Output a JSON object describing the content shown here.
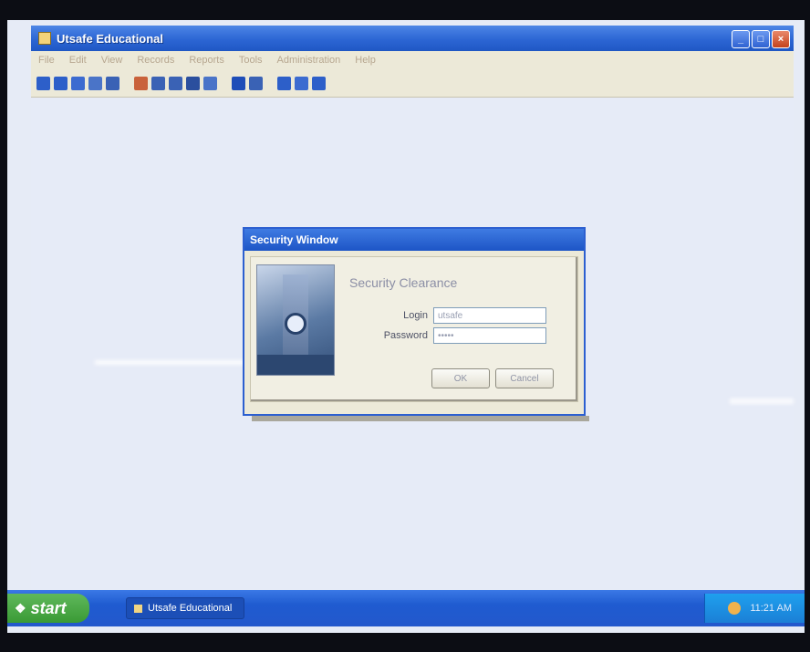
{
  "app_window": {
    "title": "Utsafe Educational",
    "menu": [
      "File",
      "Edit",
      "View",
      "Records",
      "Reports",
      "Tools",
      "Administration",
      "Help"
    ],
    "toolbar_icons": [
      {
        "name": "new-icon",
        "color": "#2d5fc9"
      },
      {
        "name": "open-icon",
        "color": "#2d5fc9"
      },
      {
        "name": "save-icon",
        "color": "#3c6bd0"
      },
      {
        "name": "edit-icon",
        "color": "#4a74c8"
      },
      {
        "name": "search-icon",
        "color": "#3a62b5"
      },
      {
        "name": "records-icon",
        "color": "#c9623b"
      },
      {
        "name": "users-icon",
        "color": "#3a62b5"
      },
      {
        "name": "reports-icon",
        "color": "#3a62b5"
      },
      {
        "name": "print-icon",
        "color": "#2b4f9e"
      },
      {
        "name": "chart-icon",
        "color": "#4a74c8"
      },
      {
        "name": "settings-icon",
        "color": "#1e4db8"
      },
      {
        "name": "help-icon",
        "color": "#3a62b5"
      },
      {
        "name": "tools-icon",
        "color": "#2d5fc9"
      },
      {
        "name": "info-icon",
        "color": "#3c6bd0"
      },
      {
        "name": "exit-icon",
        "color": "#2d5fc9"
      }
    ]
  },
  "dialog": {
    "title": "Security Window",
    "heading": "Security Clearance",
    "login_label": "Login",
    "login_value": "utsafe",
    "password_label": "Password",
    "password_value": "•••••",
    "ok_label": "OK",
    "cancel_label": "Cancel"
  },
  "taskbar": {
    "start_label": "start",
    "task_label": "Utsafe Educational",
    "clock": "11:21 AM"
  }
}
